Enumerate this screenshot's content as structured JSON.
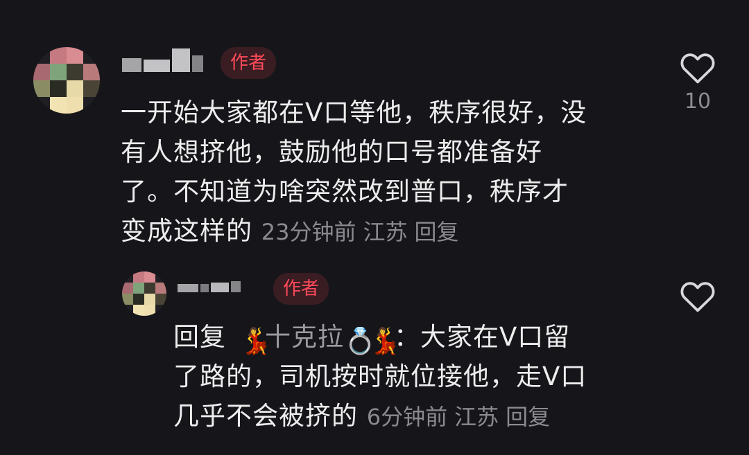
{
  "comment": {
    "badge": "作者",
    "lines": [
      "一开始大家都在V口等他，秩序很好，没",
      "有人想挤他，鼓励他的口号都准备好",
      "了。不知道为啥突然改到普口，秩序才",
      "变成这样的"
    ],
    "time": "23分钟前",
    "location": "江苏",
    "reply_label": "回复",
    "like_count": "10"
  },
  "reply": {
    "badge": "作者",
    "prefix": "回复",
    "mention_name": "十克拉",
    "mention_emoji_dancer": "💃",
    "mention_emoji_ring": "💍",
    "colon": "：",
    "line1_text": "大家在V口留",
    "lines": [
      "了路的，司机按时就位接他，走V口",
      "几乎不会被挤的"
    ],
    "time": "6分钟前",
    "location": "江苏",
    "reply_label": "回复"
  },
  "colors": {
    "background": "#16161a",
    "badge_bg": "#3a1d22",
    "badge_text": "#ff4a5a",
    "meta_text": "#8a8a90"
  }
}
